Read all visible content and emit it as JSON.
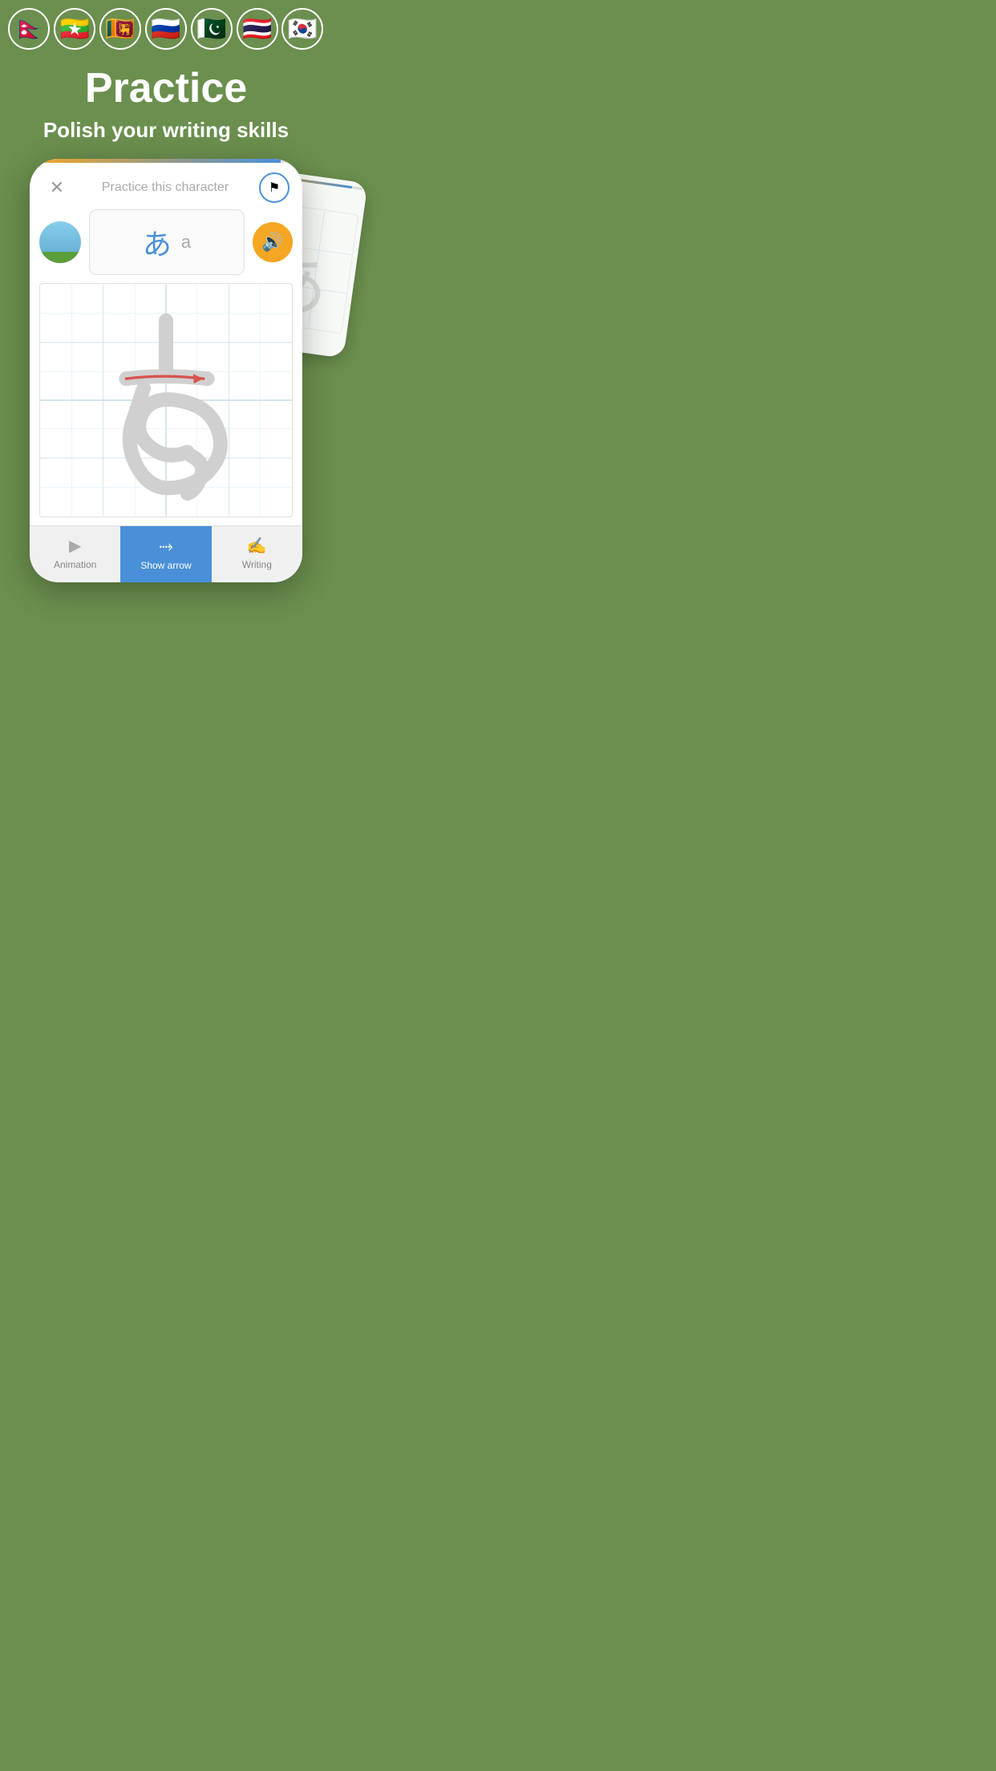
{
  "flags": [
    {
      "emoji": "🇳🇵",
      "name": "Nepal"
    },
    {
      "emoji": "🇲🇲",
      "name": "Myanmar"
    },
    {
      "emoji": "🇱🇰",
      "name": "Sri Lanka"
    },
    {
      "emoji": "🇷🇺",
      "name": "Russia"
    },
    {
      "emoji": "🇵🇰",
      "name": "Pakistan"
    },
    {
      "emoji": "🇹🇭",
      "name": "Thailand"
    },
    {
      "emoji": "🇰🇷",
      "name": "South Korea"
    }
  ],
  "hero": {
    "title": "Practice",
    "subtitle": "Polish your writing skills"
  },
  "phone": {
    "header": {
      "title": "Practice this character",
      "close_label": "×"
    },
    "character": {
      "hiragana": "あ",
      "romaji": "a"
    },
    "tabs": [
      {
        "label": "Animation",
        "icon": "▶",
        "active": false
      },
      {
        "label": "Show arrow",
        "icon": "→",
        "active": true
      },
      {
        "label": "Writing",
        "icon": "✍",
        "active": false
      }
    ]
  },
  "colors": {
    "bg_green": "#6b8f4e",
    "accent_blue": "#4a90d9",
    "accent_orange": "#f5a623",
    "grid_line": "#c5dff0",
    "char_gray": "#cccccc"
  }
}
